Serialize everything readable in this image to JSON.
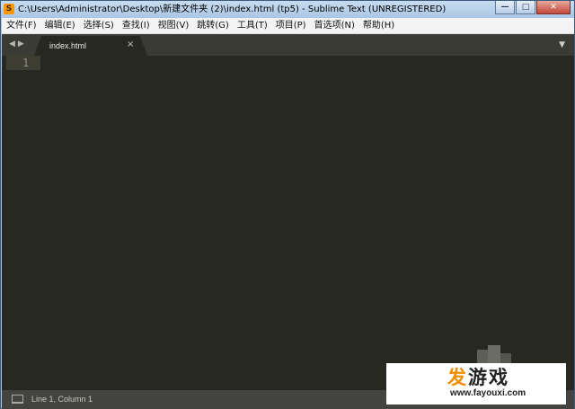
{
  "window": {
    "title": "C:\\Users\\Administrator\\Desktop\\新建文件夹 (2)\\index.html (tp5) - Sublime Text (UNREGISTERED)",
    "app_icon_glyph": "S",
    "controls": {
      "minimize": "—",
      "maximize": "□",
      "close": "✕"
    }
  },
  "menubar": {
    "items": [
      "文件(F)",
      "编辑(E)",
      "选择(S)",
      "查找(I)",
      "视图(V)",
      "跳转(G)",
      "工具(T)",
      "项目(P)",
      "首选项(N)",
      "帮助(H)"
    ]
  },
  "tabbar": {
    "nav_prev": "◀",
    "nav_next": "▶",
    "tabs": [
      {
        "title": "index.html",
        "close": "×",
        "active": true
      }
    ],
    "menu_arrow": "▼"
  },
  "editor": {
    "line_numbers": [
      "1"
    ],
    "content": ""
  },
  "statusbar": {
    "icon": "console-icon",
    "position_text": "Line 1, Column 1"
  },
  "watermark": {
    "logo_accent": "发",
    "logo_rest": "游戏",
    "url": "www.fayouxi.com"
  },
  "colors": {
    "editor_bg": "#272822",
    "tabbar_bg": "#3b3b36",
    "statusbar_bg": "#434340",
    "watermark_accent": "#f28c00"
  }
}
